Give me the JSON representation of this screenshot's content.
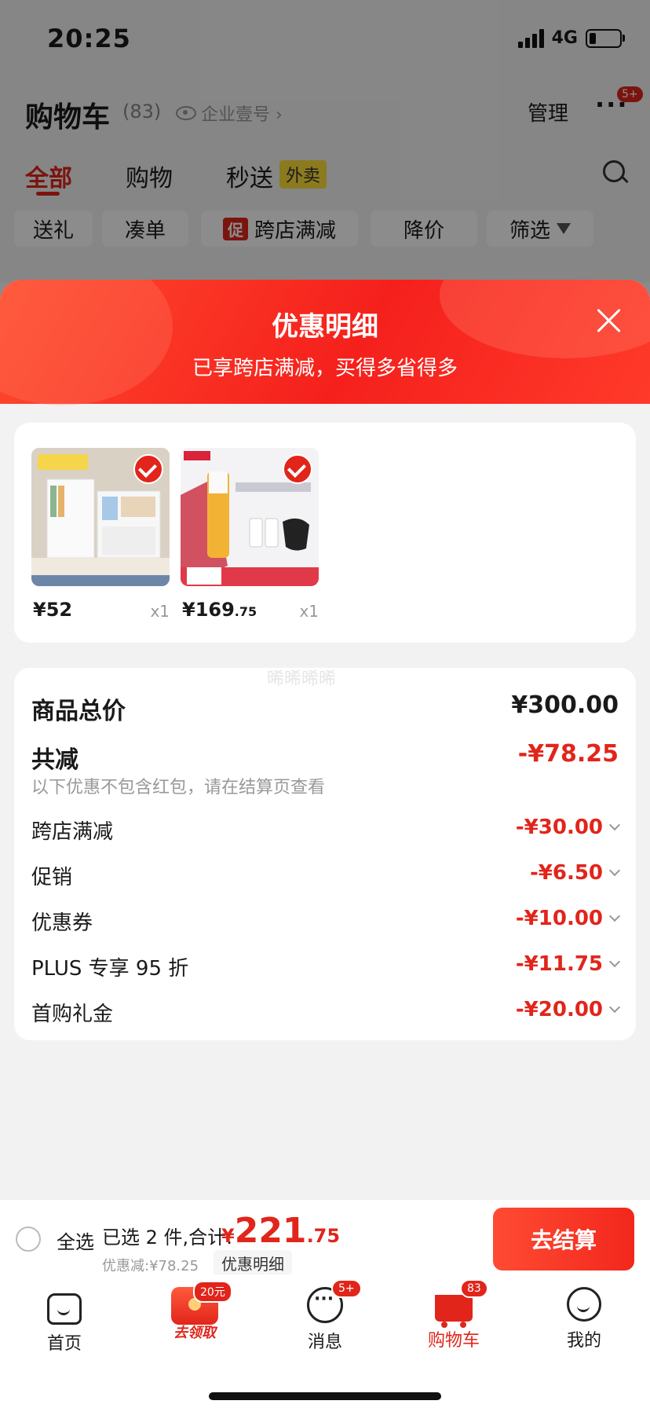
{
  "status_bar": {
    "time": "20:25",
    "network": "4G"
  },
  "header": {
    "title": "购物车",
    "count": "(83)",
    "enterprise": "企业壹号 ›",
    "manage": "管理",
    "more": "···",
    "more_badge": "5+"
  },
  "tabs": {
    "all": "全部",
    "shopping": "购物",
    "express": "秒送",
    "takeout": "外卖"
  },
  "filters": {
    "gift": "送礼",
    "bundle": "凑单",
    "promo_tag": "促",
    "cross_store": "跨店满减",
    "price_drop": "降价",
    "filter": "筛选"
  },
  "sheet": {
    "title": "优惠明细",
    "subtitle": "已享跨店满减，买得多省得多",
    "watermark": "晞晞晞晞",
    "products": [
      {
        "price_int": "¥52",
        "price_dec": "",
        "qty": "x1"
      },
      {
        "price_int": "¥169",
        "price_dec": ".75",
        "qty": "x1"
      }
    ],
    "summary": {
      "total_label": "商品总价",
      "total_value": "¥300.00",
      "discount_label": "共减",
      "discount_value": "-¥78.25",
      "note": "以下优惠不包含红包，请在结算页查看",
      "items": [
        {
          "label": "跨店满减",
          "value": "-¥30.00"
        },
        {
          "label": "促销",
          "value": "-¥6.50"
        },
        {
          "label": "优惠券",
          "value": "-¥10.00"
        },
        {
          "label": "PLUS 专享 95 折",
          "value": "-¥11.75"
        },
        {
          "label": "首购礼金",
          "value": "-¥20.00"
        }
      ]
    }
  },
  "checkout": {
    "select_all": "全选",
    "selected": "已选 2 件,合计:",
    "yen": "¥",
    "total_int": "221",
    "total_dec": ".75",
    "saved": "优惠减:¥78.25",
    "detail": "优惠明细",
    "pay": "去结算"
  },
  "tabbar": {
    "home": "首页",
    "coupon_badge": "20元",
    "coupon": "去领取",
    "messages": "消息",
    "messages_badge": "5+",
    "cart": "购物车",
    "cart_badge": "83",
    "me": "我的"
  },
  "colors": {
    "accent": "#e1251b",
    "takeout": "#ffde3a"
  }
}
